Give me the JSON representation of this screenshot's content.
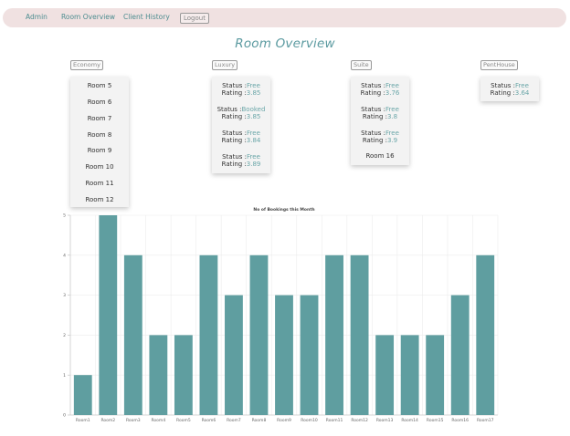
{
  "nav": {
    "items": [
      {
        "label": "Admin"
      },
      {
        "label": "Room Overview"
      },
      {
        "label": "Client History"
      }
    ],
    "logout_label": "Logout"
  },
  "page_title": "Room Overview",
  "categories": {
    "economy": {
      "label": "Economy",
      "rooms": [
        "Room 5",
        "Room 6",
        "Room 7",
        "Room 8",
        "Room 9",
        "Room 10",
        "Room 11",
        "Room 12"
      ]
    },
    "luxury": {
      "label": "Luxury",
      "entries": [
        {
          "status_prefix": "Status :",
          "status": "Free",
          "rating_prefix": "Rating :",
          "rating": "3.85"
        },
        {
          "status_prefix": "Status :",
          "status": "Booked",
          "rating_prefix": "Rating :",
          "rating": "3.85"
        },
        {
          "status_prefix": "Status :",
          "status": "Free",
          "rating_prefix": "Rating :",
          "rating": "3.84"
        },
        {
          "status_prefix": "Status :",
          "status": "Free",
          "rating_prefix": "Rating :",
          "rating": "3.89"
        }
      ]
    },
    "suite": {
      "label": "Suite",
      "entries": [
        {
          "status_prefix": "Status :",
          "status": "Free",
          "rating_prefix": "Rating :",
          "rating": "3.76"
        },
        {
          "status_prefix": "Status :",
          "status": "Free",
          "rating_prefix": "Rating :",
          "rating": "3.8"
        },
        {
          "status_prefix": "Status :",
          "status": "Free",
          "rating_prefix": "Rating :",
          "rating": "3.9"
        }
      ],
      "extra_room": "Room 16"
    },
    "penthouse": {
      "label": "PentHouse",
      "entries": [
        {
          "status_prefix": "Status :",
          "status": "Free",
          "rating_prefix": "Rating :",
          "rating": "3.64"
        }
      ]
    }
  },
  "colors": {
    "accent": "#5f9ea0",
    "nav_bg": "#f0e1e1",
    "value_text": "#6aa6a8"
  },
  "chart_data": {
    "type": "bar",
    "title": "No of Bookings this Month",
    "categories": [
      "Room1",
      "Room2",
      "Room3",
      "Room4",
      "Room5",
      "Room6",
      "Room7",
      "Room8",
      "Room9",
      "Room10",
      "Room11",
      "Room12",
      "Room13",
      "Room14",
      "Room15",
      "Room16",
      "Room17"
    ],
    "values": [
      1,
      5,
      4,
      2,
      2,
      4,
      3,
      4,
      3,
      3,
      4,
      4,
      2,
      2,
      2,
      3,
      4
    ],
    "ylim": [
      0,
      5
    ],
    "yticks": [
      0,
      1,
      2,
      3,
      4,
      5
    ],
    "grid": true,
    "bar_color": "#5f9ea0"
  }
}
